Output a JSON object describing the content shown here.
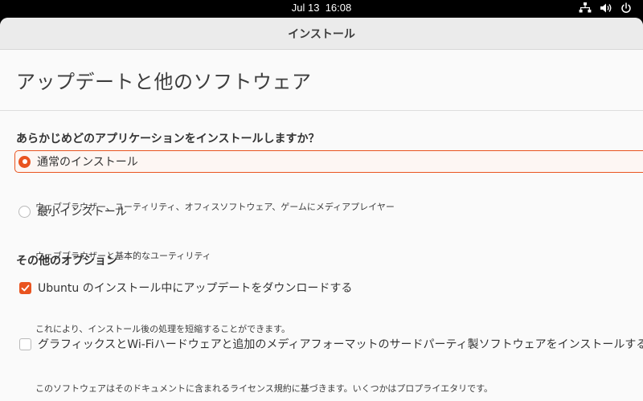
{
  "topbar": {
    "date": "Jul 13",
    "time": "16:08",
    "tray_icons": [
      "network-icon",
      "volume-icon",
      "power-icon"
    ]
  },
  "window": {
    "title": "インストール"
  },
  "page": {
    "title": "アップデートと他のソフトウェア"
  },
  "install_type": {
    "heading": "あらかじめどのアプリケーションをインストールしますか？",
    "options": [
      {
        "label": "通常のインストール",
        "description": "ウェブブラウザー、ユーティリティ、オフィスソフトウェア、ゲームにメディアプレイヤー",
        "selected": true
      },
      {
        "label": "最小インストール",
        "description": "ウェブブラウザーと基本的なユーティリティ",
        "selected": false
      }
    ]
  },
  "other_options": {
    "heading": "その他のオプション",
    "items": [
      {
        "label": "Ubuntu のインストール中にアップデートをダウンロードする",
        "description": "これにより、インストール後の処理を短縮することができます。",
        "checked": true
      },
      {
        "label": "グラフィックスとWi-Fiハードウェアと追加のメディアフォーマットのサードパーティ製ソフトウェアをインストールする",
        "description": "このソフトウェアはそのドキュメントに含まれるライセンス規約に基づきます。いくつかはプロプライエタリです。",
        "checked": false
      }
    ]
  },
  "colors": {
    "accent": "#e95420",
    "topbar_bg": "#000000",
    "window_bg": "#fafafa",
    "headerbar_bg": "#ebebeb"
  }
}
